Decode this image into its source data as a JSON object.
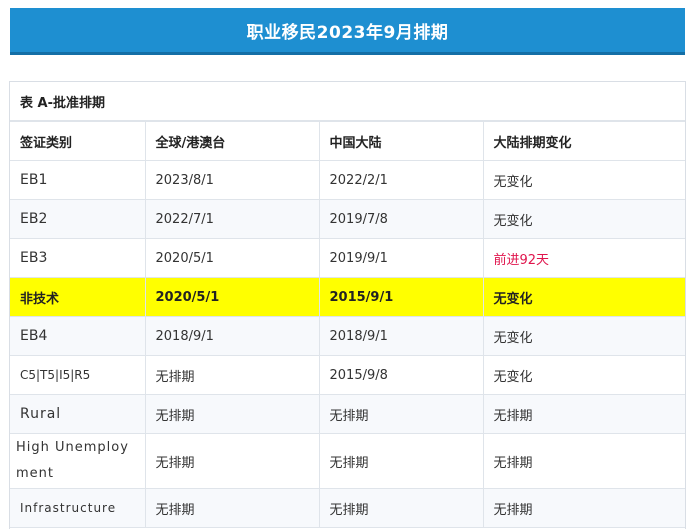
{
  "banner": {
    "title": "职业移民2023年9月排期"
  },
  "table": {
    "caption": "表 A-批准排期",
    "headers": [
      "签证类别",
      "全球/港澳台",
      "中国大陆",
      "大陆排期变化"
    ],
    "rows": [
      {
        "category": "EB1",
        "global": "2023/8/1",
        "china": "2022/2/1",
        "change": "无变化"
      },
      {
        "category": "EB2",
        "global": "2022/7/1",
        "china": "2019/7/8",
        "change": "无变化"
      },
      {
        "category": "EB3",
        "global": "2020/5/1",
        "china": "2019/9/1",
        "change": "前进92天"
      },
      {
        "category": "非技术",
        "global": "2020/5/1",
        "china": "2015/9/1",
        "change": "无变化"
      },
      {
        "category": "EB4",
        "global": "2018/9/1",
        "china": "2018/9/1",
        "change": "无变化"
      },
      {
        "category": "C5|T5|I5|R5",
        "global": "无排期",
        "china": "2015/9/8",
        "change": "无变化"
      },
      {
        "category": "Rural",
        "global": "无排期",
        "china": "无排期",
        "change": "无排期"
      },
      {
        "category": "High Unemployment",
        "global": "无排期",
        "china": "无排期",
        "change": "无排期"
      },
      {
        "category": "Infrastructure",
        "global": "无排期",
        "china": "无排期",
        "change": "无排期"
      }
    ]
  },
  "colors": {
    "banner": "#1e8fd1",
    "highlight": "#ffff00",
    "advance": "#e0144c"
  }
}
